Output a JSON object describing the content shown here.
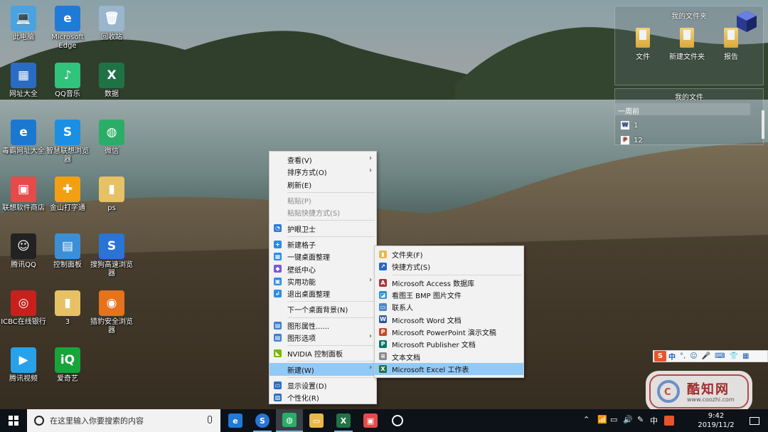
{
  "desktop": {
    "icons": [
      {
        "label": "此电脑",
        "glyph": "💻",
        "color": "#4aa3e0"
      },
      {
        "label": "Microsoft Edge",
        "glyph": "e",
        "color": "#1f7ad8"
      },
      {
        "label": "回收站",
        "glyph": "🗑",
        "color": "#9ab6cc"
      },
      {
        "label": "网址大全",
        "glyph": "▦",
        "color": "#2a6cc4"
      },
      {
        "label": "QQ音乐",
        "glyph": "♪",
        "color": "#31c27c"
      },
      {
        "label": "数据",
        "glyph": "X",
        "color": "#1f7245"
      },
      {
        "label": "毒霸网址大全",
        "glyph": "e",
        "color": "#1b78d0"
      },
      {
        "label": "智慧联想浏览器",
        "glyph": "S",
        "color": "#1a8fe3"
      },
      {
        "label": "微信",
        "glyph": "◍",
        "color": "#2aae67"
      },
      {
        "label": "联想软件商店",
        "glyph": "▣",
        "color": "#e54b4b"
      },
      {
        "label": "金山打字通",
        "glyph": "✚",
        "color": "#f2a012"
      },
      {
        "label": "ps",
        "glyph": "▮",
        "color": "#e7c165"
      },
      {
        "label": "腾讯QQ",
        "glyph": "☺",
        "color": "#222222"
      },
      {
        "label": "控制面板",
        "glyph": "▤",
        "color": "#3b8fd6"
      },
      {
        "label": "搜狗高速浏览器",
        "glyph": "S",
        "color": "#2a74d5"
      },
      {
        "label": "ICBC在线银行",
        "glyph": "◎",
        "color": "#c8201c"
      },
      {
        "label": "3",
        "glyph": "▮",
        "color": "#e7c165"
      },
      {
        "label": "猎豹安全浏览器",
        "glyph": "◉",
        "color": "#e5721c"
      },
      {
        "label": "腾讯视频",
        "glyph": "▶",
        "color": "#27a2e8"
      },
      {
        "label": "爱奇艺",
        "glyph": "iQ",
        "color": "#17a53a"
      }
    ]
  },
  "fence_top": {
    "title": "我的文件夹",
    "items": [
      {
        "label": "文件"
      },
      {
        "label": "新建文件夹"
      },
      {
        "label": "报告"
      }
    ]
  },
  "fence_files": {
    "title": "我的文件",
    "group": "一周前",
    "files": [
      {
        "label": "1",
        "badge": "W"
      },
      {
        "label": "12",
        "badge": "P"
      }
    ]
  },
  "context_menu": {
    "items": [
      {
        "label": "查看(V)",
        "arrow": "›"
      },
      {
        "label": "排序方式(O)",
        "arrow": "›"
      },
      {
        "label": "刷新(E)"
      },
      {
        "label": "粘贴(P)"
      },
      {
        "label": "粘贴快捷方式(S)"
      },
      {
        "label": "护眼卫士",
        "icon": "◔",
        "color": "#2f7bd8"
      },
      {
        "label": "新建格子",
        "icon": "+",
        "color": "#2c8be8"
      },
      {
        "label": "一键桌面整理",
        "icon": "▦",
        "color": "#2c8be8"
      },
      {
        "label": "壁纸中心",
        "icon": "◆",
        "color": "#7a58d6"
      },
      {
        "label": "实用功能",
        "icon": "▣",
        "color": "#2c8be8",
        "arrow": "›"
      },
      {
        "label": "退出桌面整理",
        "icon": "↲",
        "color": "#2c8be8"
      },
      {
        "label": "下一个桌面背景(N)"
      },
      {
        "label": "图形属性......",
        "icon": "▤",
        "color": "#3d7fd0"
      },
      {
        "label": "图形选项",
        "icon": "▤",
        "color": "#3d7fd0",
        "arrow": "›"
      },
      {
        "label": "NVIDIA 控制面板",
        "icon": "◣",
        "color": "#76b900"
      },
      {
        "label": "新建(W)",
        "arrow": "›"
      },
      {
        "label": "显示设置(D)",
        "icon": "▭",
        "color": "#2b6fc4"
      },
      {
        "label": "个性化(R)",
        "icon": "▨",
        "color": "#2b6fc4"
      }
    ]
  },
  "new_submenu": {
    "items": [
      {
        "label": "文件夹(F)",
        "icon": "▮",
        "color": "#e8b94a"
      },
      {
        "label": "快捷方式(S)",
        "icon": "↗",
        "color": "#2a65c4"
      },
      {
        "label": "Microsoft Access 数据库",
        "icon": "A",
        "color": "#a4373a"
      },
      {
        "label": "看图王 BMP 图片文件",
        "icon": "◪",
        "color": "#2d8fd6"
      },
      {
        "label": "联系人",
        "icon": "▭",
        "color": "#4f88c6"
      },
      {
        "label": "Microsoft Word 文档",
        "icon": "W",
        "color": "#2b579a"
      },
      {
        "label": "Microsoft PowerPoint 演示文稿",
        "icon": "P",
        "color": "#c9472a"
      },
      {
        "label": "Microsoft Publisher 文档",
        "icon": "P",
        "color": "#077568"
      },
      {
        "label": "文本文档",
        "icon": "≡",
        "color": "#8a8a8a"
      },
      {
        "label": "Microsoft Excel 工作表",
        "icon": "X",
        "color": "#217346"
      }
    ]
  },
  "taskbar": {
    "search_placeholder": "在这里输入你要搜索的内容",
    "tray_ime": "中",
    "time": "9:42",
    "date": "2019/11/2"
  },
  "ime_bar": {
    "brand": "S",
    "label": "中"
  },
  "watermark": {
    "brand": "酷知网",
    "url": "www.coozhi.com"
  }
}
